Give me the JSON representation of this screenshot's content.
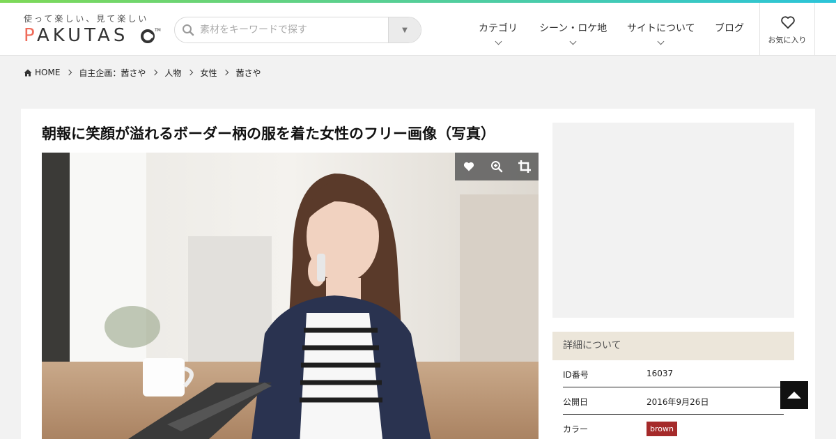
{
  "header": {
    "logo_tagline": "使って楽しい、見て楽しい",
    "logo_word": "PAKUTAS",
    "logo_tm": "TM",
    "search_placeholder": "素材をキーワードで探す",
    "nav": [
      {
        "label": "カテゴリ"
      },
      {
        "label": "シーン・ロケ地"
      },
      {
        "label": "サイトについて"
      },
      {
        "label": "ブログ"
      }
    ],
    "favorites_label": "お気に入り"
  },
  "breadcrumb": [
    "HOME",
    "自主企画：茜さや",
    "人物",
    "女性",
    "茜さや"
  ],
  "main": {
    "title": "朝報に笑顔が溢れるボーダー柄の服を着た女性のフリー画像（写真）",
    "tools": [
      {
        "icon": "heart-icon"
      },
      {
        "icon": "zoom-in-icon"
      },
      {
        "icon": "crop-icon"
      }
    ]
  },
  "details": {
    "heading": "詳細について",
    "rows": [
      {
        "key": "ID番号",
        "value": "16037"
      },
      {
        "key": "公開日",
        "value": "2016年9月26日"
      },
      {
        "key": "カラー",
        "value": "brown"
      }
    ],
    "badge_color": "#a52a2a"
  },
  "colors": {
    "accent_gradient_start": "#7ed957",
    "accent_gradient_end": "#2bc4d9",
    "logo_accent": "#ef6b5a"
  }
}
